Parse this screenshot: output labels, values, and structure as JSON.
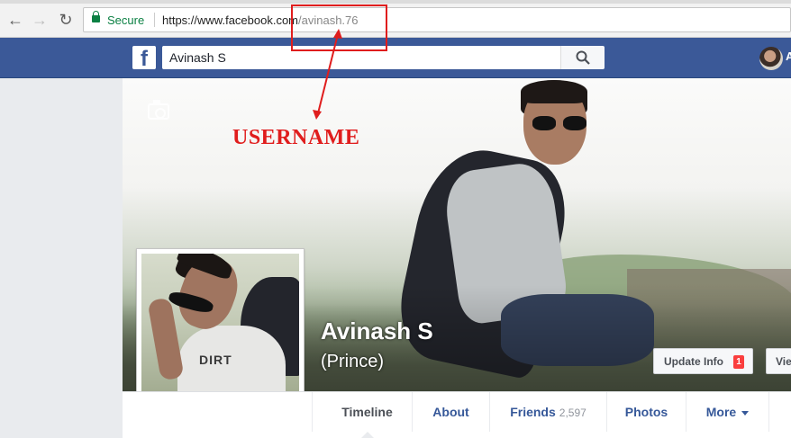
{
  "browser": {
    "secure_label": "Secure",
    "url_host": "https://www.facebook.com",
    "url_path": "/avinash.76"
  },
  "fb": {
    "search_value": "Avinash S",
    "user_short": "A",
    "brand_color": "#3b5998"
  },
  "profile": {
    "name": "Avinash S",
    "alternate_name": "(Prince)",
    "update_info_label": "Update Info",
    "update_info_badge": "1",
    "view_label": "Vie",
    "shirt_text": "DIRT"
  },
  "tabs": [
    {
      "label": "Timeline",
      "active": true
    },
    {
      "label": "About"
    },
    {
      "label": "Friends",
      "count": "2,597"
    },
    {
      "label": "Photos"
    },
    {
      "label": "More"
    }
  ],
  "annotation": {
    "label": "USERNAME",
    "color": "#e01d1d"
  }
}
